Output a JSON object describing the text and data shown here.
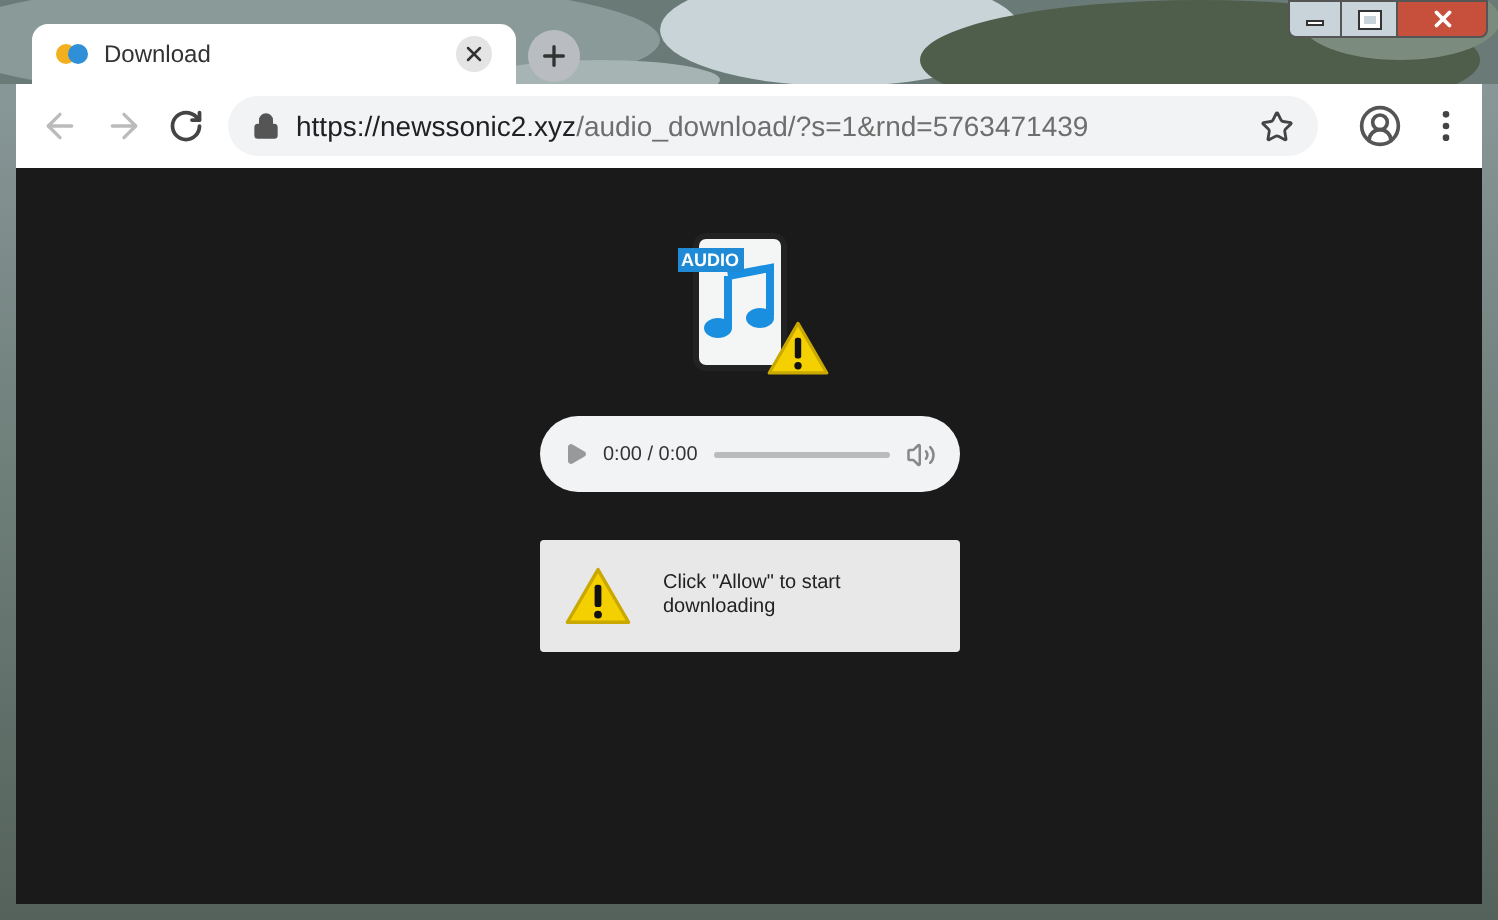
{
  "tab": {
    "title": "Download",
    "selected": true
  },
  "address_bar": {
    "host": "https://newssonic2.xyz",
    "path": "/audio_download/?s=1&rnd=5763471439"
  },
  "file_icon": {
    "badge": "AUDIO"
  },
  "audio_player": {
    "time": "0:00 / 0:00"
  },
  "notice": {
    "text": "Click \"Allow\" to start downloading"
  }
}
